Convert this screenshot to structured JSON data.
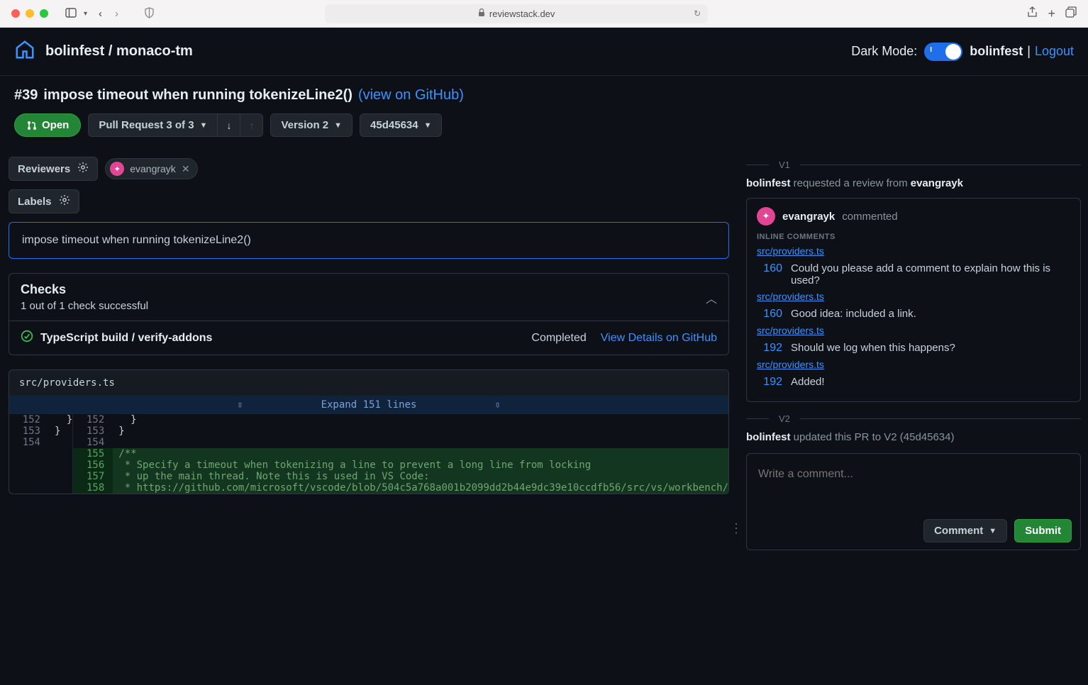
{
  "browser": {
    "url_host": "reviewstack.dev"
  },
  "topbar": {
    "repo_owner": "bolinfest",
    "repo_sep": " / ",
    "repo_name": "monaco-tm",
    "dark_mode_label": "Dark Mode:",
    "user": "bolinfest",
    "pipe": " | ",
    "logout": "Logout"
  },
  "pr": {
    "number": "#39",
    "title": "impose timeout when running tokenizeLine2()",
    "view_on_github": "(view on GitHub)",
    "state_label": "Open",
    "selector_label": "Pull Request 3 of 3",
    "version_label": "Version 2",
    "commit_label": "45d45634"
  },
  "reviewers": {
    "label": "Reviewers",
    "chip_user": "evangrayk"
  },
  "labels": {
    "label": "Labels"
  },
  "commit_message": "impose timeout when running tokenizeLine2()",
  "checks": {
    "title": "Checks",
    "summary": "1 out of 1 check successful",
    "item_name": "TypeScript build / verify-addons",
    "item_status": "Completed",
    "item_link": "View Details on GitHub"
  },
  "diff": {
    "file": "src/providers.ts",
    "expand_label": "Expand 151 lines",
    "left_lines": [
      {
        "no": "152",
        "code": "  }"
      },
      {
        "no": "153",
        "code": "}"
      },
      {
        "no": "154",
        "code": ""
      }
    ],
    "right_lines": [
      {
        "no": "152",
        "code": "  }",
        "added": false
      },
      {
        "no": "153",
        "code": "}",
        "added": false
      },
      {
        "no": "154",
        "code": "",
        "added": false
      },
      {
        "no": "155",
        "code": "/**",
        "added": true
      },
      {
        "no": "156",
        "code": " * Specify a timeout when tokenizing a line to prevent a long line from locking",
        "added": true
      },
      {
        "no": "157",
        "code": " * up the main thread. Note this is used in VS Code:",
        "added": true
      },
      {
        "no": "158",
        "code": " * https://github.com/microsoft/vscode/blob/504c5a768a001b2099dd2b44e9dc39e10ccdfb56/src/vs/workbench/",
        "added": true
      }
    ]
  },
  "timeline": {
    "v1_label": "V1",
    "v2_label": "V2",
    "review_request_user": "bolinfest",
    "review_request_text": " requested a review from ",
    "review_request_target": "evangrayk",
    "commenter": "evangrayk",
    "commented_label": "commented",
    "inline_comments_header": "INLINE COMMENTS",
    "comments": [
      {
        "src": "src/providers.ts",
        "line": "160",
        "text": "Could you please add a comment to explain how this is used?"
      },
      {
        "src": "src/providers.ts",
        "line": "160",
        "text": "Good idea: included a link."
      },
      {
        "src": "src/providers.ts",
        "line": "192",
        "text": "Should we log when this happens?"
      },
      {
        "src": "src/providers.ts",
        "line": "192",
        "text": "Added!"
      }
    ],
    "update_user": "bolinfest",
    "update_text": " updated this PR to V2 (45d45634)"
  },
  "comment_box": {
    "placeholder": "Write a comment...",
    "comment_btn": "Comment",
    "submit_btn": "Submit"
  }
}
